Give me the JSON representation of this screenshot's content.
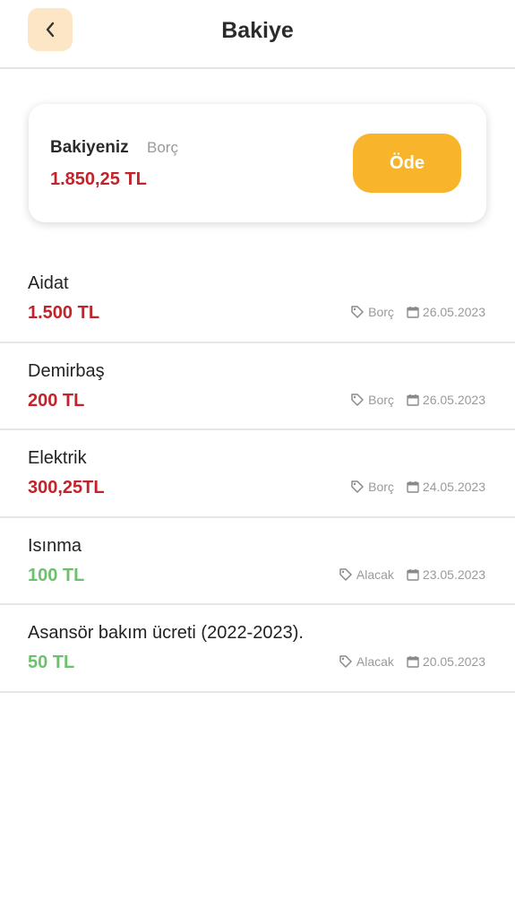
{
  "header": {
    "title": "Bakiye",
    "back_icon": "chevron-left-icon"
  },
  "balance": {
    "label": "Bakiyeniz",
    "type": "Borç",
    "amount": "1.850,25 TL",
    "pay_label": "Öde"
  },
  "transactions": [
    {
      "title": "Aidat",
      "amount": "1.500 TL",
      "kind": "Borç",
      "date": "26.05.2023",
      "status": "debt"
    },
    {
      "title": "Demirbaş",
      "amount": "200 TL",
      "kind": "Borç",
      "date": "26.05.2023",
      "status": "debt"
    },
    {
      "title": "Elektrik",
      "amount": "300,25TL",
      "kind": "Borç",
      "date": "24.05.2023",
      "status": "debt"
    },
    {
      "title": "Isınma",
      "amount": "100 TL",
      "kind": "Alacak",
      "date": "23.05.2023",
      "status": "credit"
    },
    {
      "title": "Asansör bakım ücreti (2022-2023).",
      "amount": "50 TL",
      "kind": "Alacak",
      "date": "20.05.2023",
      "status": "credit"
    }
  ],
  "colors": {
    "accent": "#f8b42b",
    "back_bg": "#fde6c6",
    "debt": "#c3232a",
    "credit": "#6cc16c",
    "muted": "#9a9a9a"
  }
}
